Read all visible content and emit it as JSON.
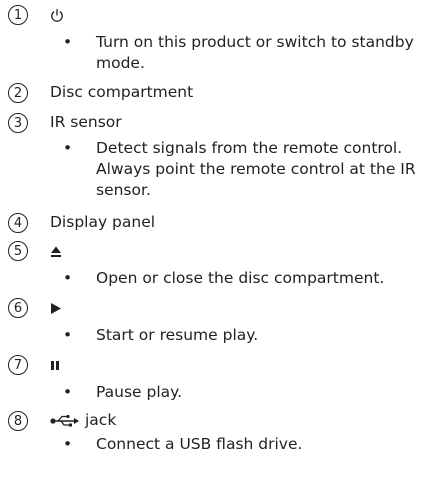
{
  "items": [
    {
      "number": "1",
      "icon": "power-icon",
      "title": "",
      "bullets": [
        "Turn on this product or switch to standby mode."
      ]
    },
    {
      "number": "2",
      "title": "Disc compartment",
      "bullets": []
    },
    {
      "number": "3",
      "title": "IR sensor",
      "bullets": [
        "Detect signals from the remote control. Always point the remote control at the IR sensor."
      ]
    },
    {
      "number": "4",
      "title": "Display panel",
      "bullets": []
    },
    {
      "number": "5",
      "icon": "eject-icon",
      "title": "",
      "bullets": [
        "Open or close the disc compartment."
      ]
    },
    {
      "number": "6",
      "icon": "play-icon",
      "title": "",
      "bullets": [
        "Start or resume play."
      ]
    },
    {
      "number": "7",
      "icon": "pause-icon",
      "title": "",
      "bullets": [
        "Pause play."
      ]
    },
    {
      "number": "8",
      "icon": "usb-icon",
      "title": "jack",
      "bullets": [
        "Connect a USB flash drive."
      ]
    }
  ],
  "bullet_glyph": "•",
  "colors": {
    "text": "#231f20"
  }
}
